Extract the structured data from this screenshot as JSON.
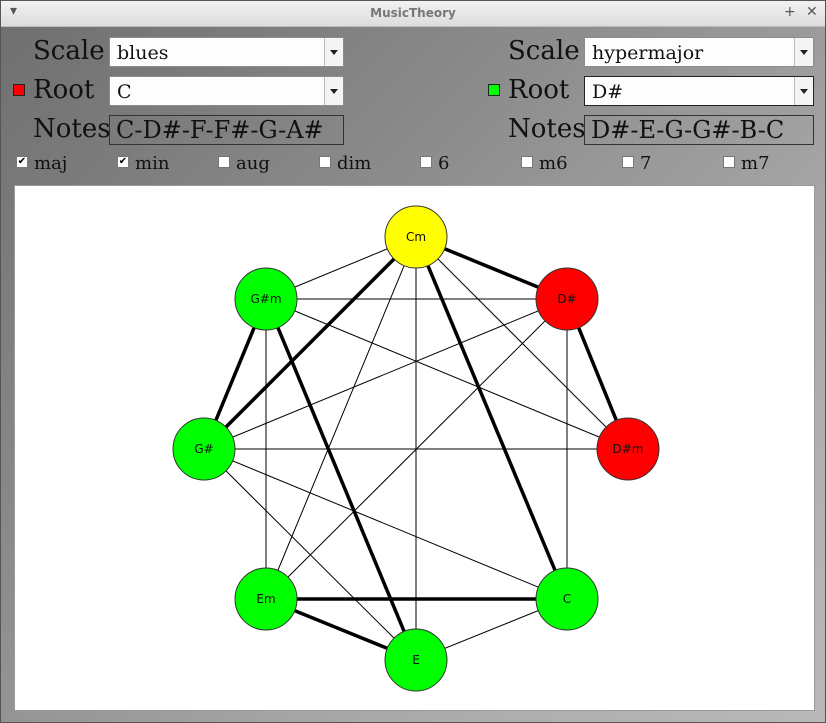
{
  "window": {
    "title": "MusicTheory"
  },
  "left": {
    "scale_label": "Scale",
    "scale_value": "blues",
    "root_label": "Root",
    "root_value": "C",
    "root_color": "#ff0000",
    "notes_label": "Notes",
    "notes_value": "C-D#-F-F#-G-A#"
  },
  "right": {
    "scale_label": "Scale",
    "scale_value": "hypermajor",
    "root_label": "Root",
    "root_value": "D#",
    "root_color": "#00ff00",
    "notes_label": "Notes",
    "notes_value": "D#-E-G-G#-B-C"
  },
  "chords": [
    {
      "label": "maj",
      "checked": true
    },
    {
      "label": "min",
      "checked": true
    },
    {
      "label": "aug",
      "checked": false
    },
    {
      "label": "dim",
      "checked": false
    },
    {
      "label": "6",
      "checked": false
    },
    {
      "label": "m6",
      "checked": false
    },
    {
      "label": "7",
      "checked": false
    },
    {
      "label": "m7",
      "checked": false
    }
  ],
  "graph": {
    "nodes": [
      {
        "id": "Cm",
        "color": "#ffff00"
      },
      {
        "id": "D#",
        "color": "#ff0000"
      },
      {
        "id": "D#m",
        "color": "#ff0000"
      },
      {
        "id": "C",
        "color": "#00ff00"
      },
      {
        "id": "E",
        "color": "#00ff00"
      },
      {
        "id": "Em",
        "color": "#00ff00"
      },
      {
        "id": "G#",
        "color": "#00ff00"
      },
      {
        "id": "G#m",
        "color": "#00ff00"
      }
    ],
    "edges_thick": [
      [
        "Cm",
        "D#"
      ],
      [
        "Cm",
        "C"
      ],
      [
        "Cm",
        "G#"
      ],
      [
        "D#",
        "D#m"
      ],
      [
        "G#m",
        "G#"
      ],
      [
        "G#m",
        "E"
      ],
      [
        "Em",
        "C"
      ],
      [
        "Em",
        "E"
      ]
    ],
    "edges_thin": [
      [
        "Cm",
        "G#m"
      ],
      [
        "Cm",
        "E"
      ],
      [
        "Cm",
        "Em"
      ],
      [
        "Cm",
        "D#m"
      ],
      [
        "D#",
        "G#m"
      ],
      [
        "D#",
        "G#"
      ],
      [
        "D#",
        "Em"
      ],
      [
        "D#",
        "C"
      ],
      [
        "D#m",
        "G#m"
      ],
      [
        "D#m",
        "G#"
      ],
      [
        "C",
        "G#"
      ],
      [
        "C",
        "E"
      ],
      [
        "E",
        "G#"
      ],
      [
        "Em",
        "G#m"
      ]
    ]
  }
}
